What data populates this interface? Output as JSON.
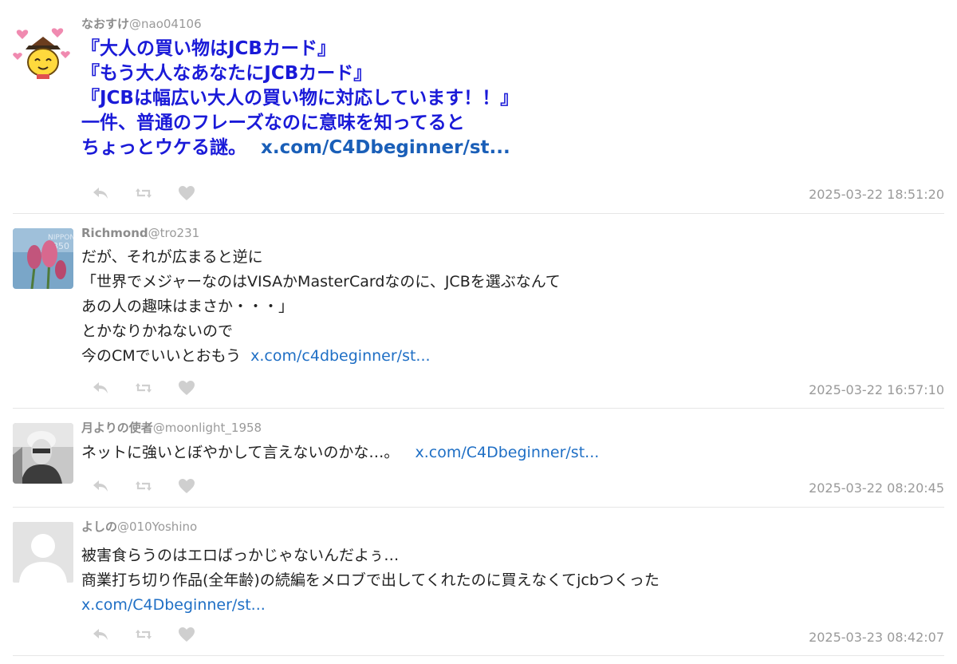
{
  "tweets": [
    {
      "name": "なおすけ",
      "handle": "@nao04106",
      "lines": [
        "『大人の買い物はJCBカード』",
        "『もう大人なあなたにJCBカード』",
        "『JCBは幅広い大人の買い物に対応しています！！』",
        "一件、普通のフレーズなのに意味を知ってると"
      ],
      "last_line": "ちょっとウケる謎。",
      "link": "x.com/C4Dbeginner/st...",
      "timestamp": "2025-03-22 18:51:20"
    },
    {
      "name": "Richmond",
      "handle": "@tro231",
      "lines": [
        "だが、それが広まると逆に",
        "「世界でメジャーなのはVISAかMasterCardなのに、JCBを選ぶなんて",
        "あの人の趣味はまさか・・・」",
        "とかなりかねないので"
      ],
      "last_line": "今のCMでいいとおもう",
      "link": "x.com/c4dbeginner/st...",
      "timestamp": "2025-03-22 16:57:10"
    },
    {
      "name": "月よりの使者",
      "handle": "@moonlight_1958",
      "lines": [],
      "last_line": "ネットに強いとぼやかして言えないのかな…。",
      "link": "x.com/C4Dbeginner/st...",
      "timestamp": "2025-03-22 08:20:45"
    },
    {
      "name": "よしの",
      "handle": "@010Yoshino",
      "lines": [
        "被害食らうのはエロばっかじゃないんだよぅ…",
        "商業打ち切り作品(全年齢)の続編をメロブで出してくれたのに買えなくてjcbつくった"
      ],
      "last_line": "",
      "link": "x.com/C4Dbeginner/st...",
      "timestamp": "2025-03-23 08:42:07"
    }
  ],
  "icons": {
    "reply": "reply-icon",
    "retweet": "retweet-icon",
    "like": "heart-icon"
  },
  "colors": {
    "emphasis_text": "#1a1ad8",
    "link": "#1f6fc5",
    "meta": "#9a9a9a",
    "action_icon": "#cfcfcf"
  }
}
